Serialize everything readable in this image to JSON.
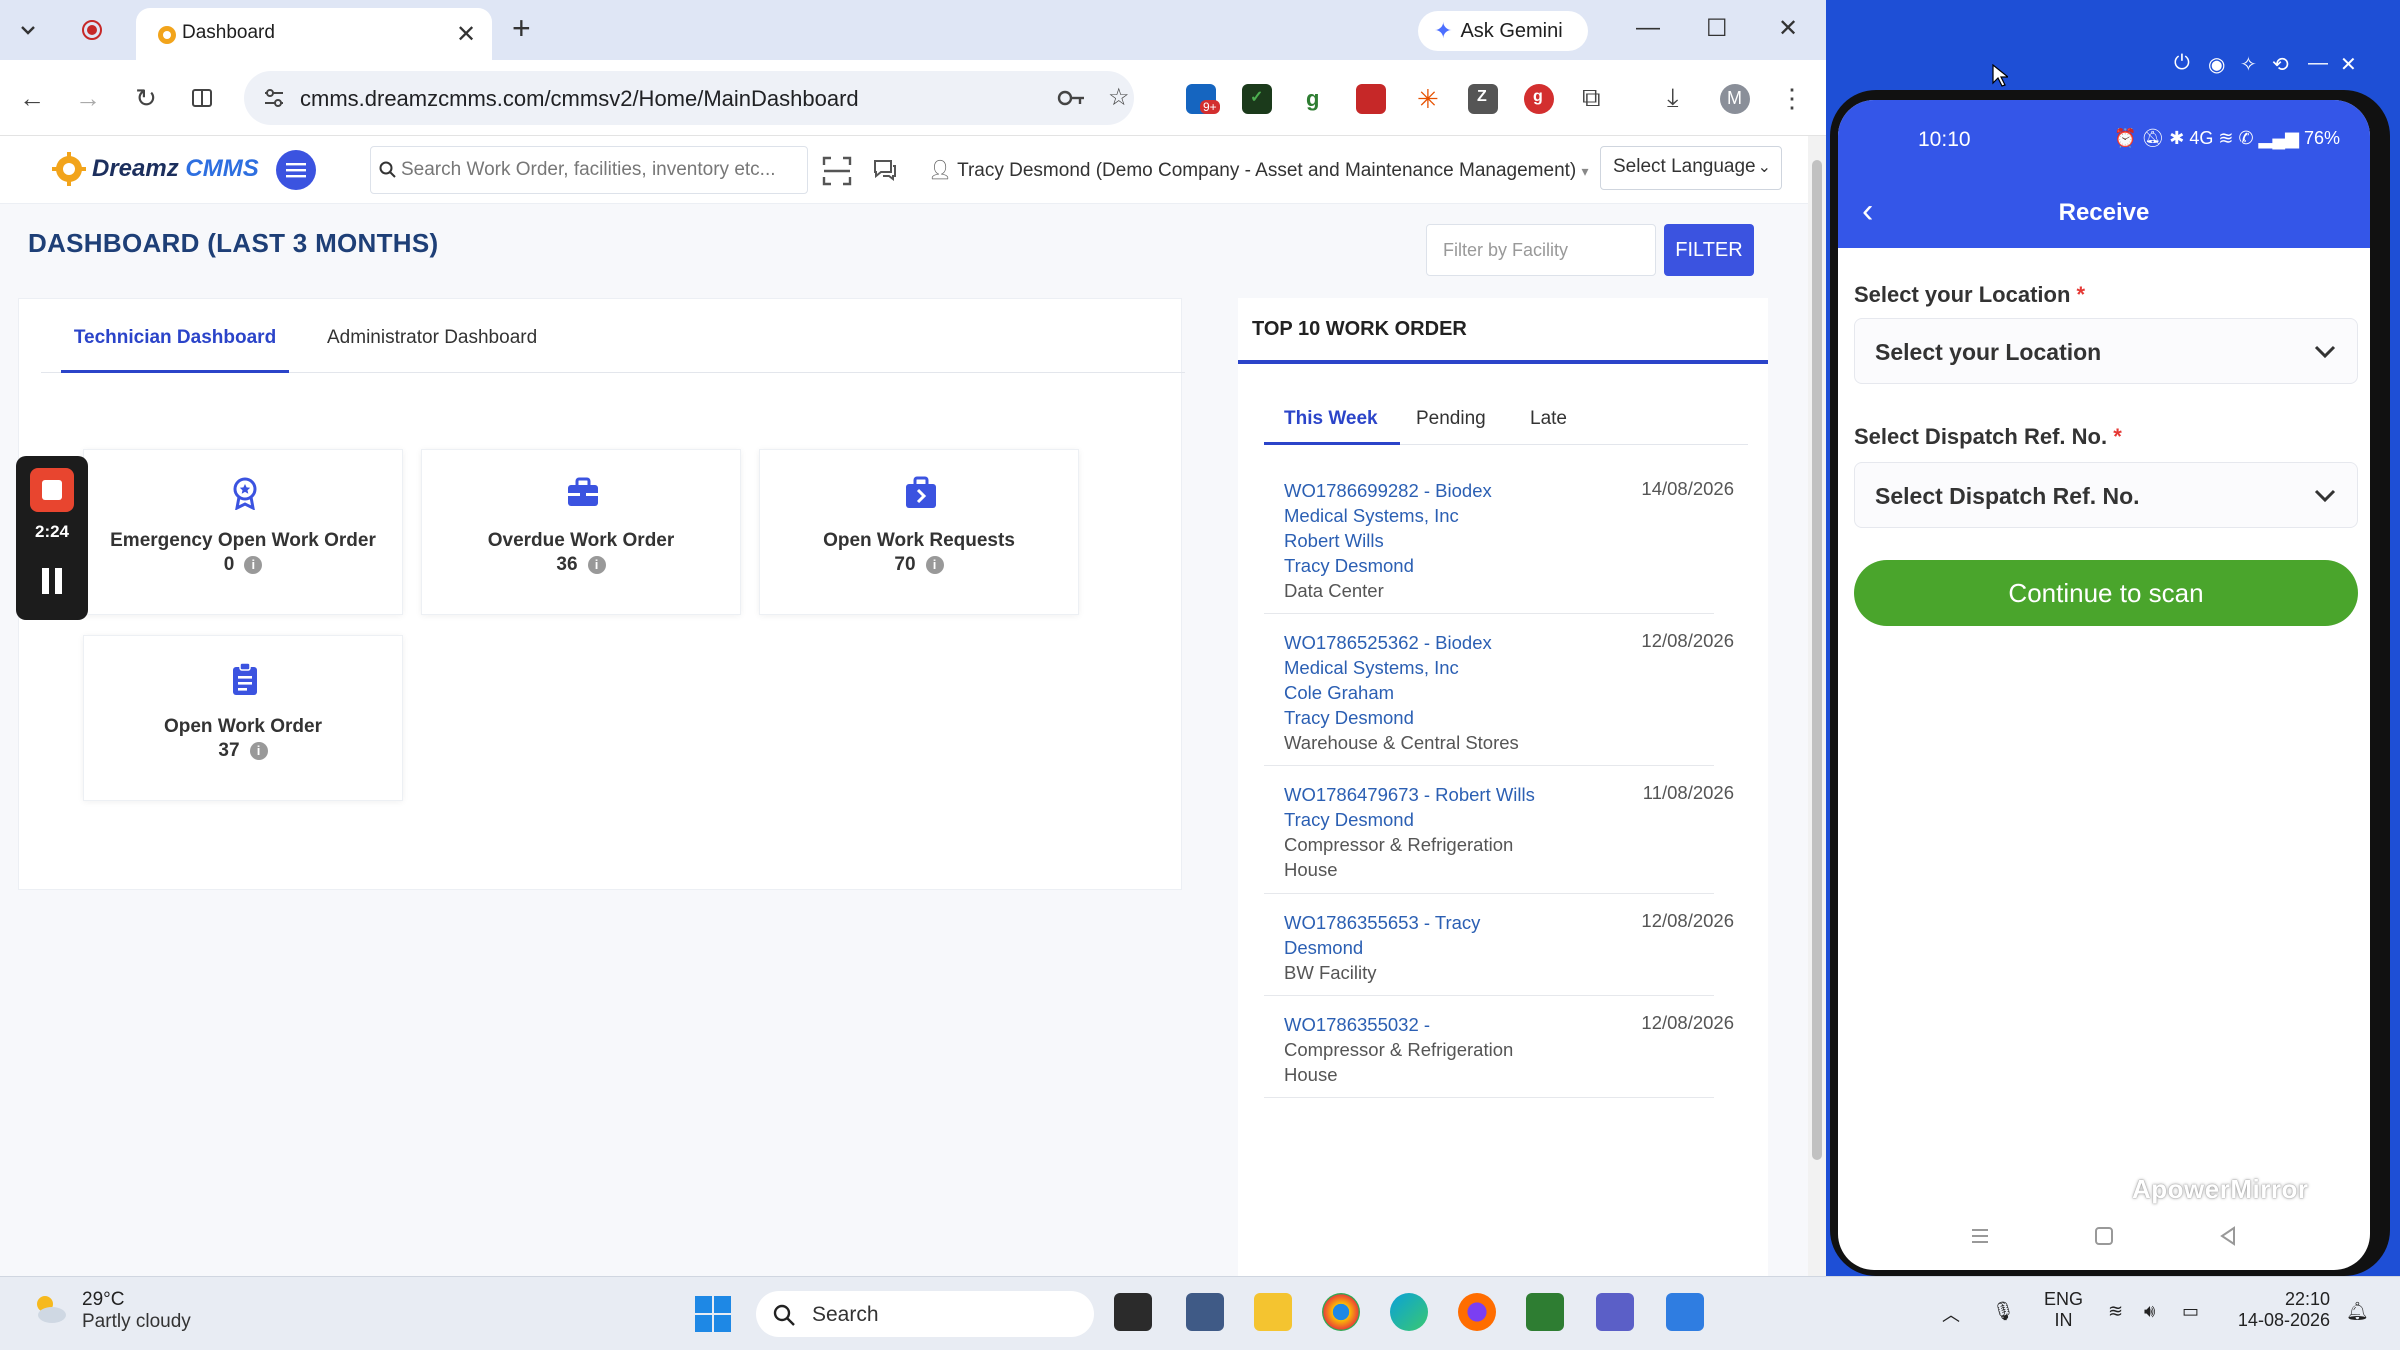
{
  "browser": {
    "tab_title": "Dashboard",
    "ask_gemini": "Ask Gemini",
    "url": "cmms.dreamzcmms.com/cmmsv2/Home/MainDashboard",
    "ext_badge": "9+",
    "profile_initial": "M"
  },
  "app": {
    "logo_prefix": "Dreamz",
    "logo_suffix": "CMMS",
    "search_placeholder": "Search Work Order, facilities, inventory etc...",
    "user": "Tracy Desmond (Demo Company - Asset and Maintenance Management)",
    "language": "Select Language"
  },
  "dashboard": {
    "title": "DASHBOARD (LAST 3 MONTHS)",
    "facility_placeholder": "Filter by Facility",
    "filter_label": "FILTER",
    "tabs": [
      "Technician Dashboard",
      "Administrator Dashboard"
    ],
    "kpis": [
      {
        "label": "Emergency Open Work Order",
        "value": "0"
      },
      {
        "label": "Overdue Work Order",
        "value": "36"
      },
      {
        "label": "Open Work Requests",
        "value": "70"
      },
      {
        "label": "Open Work Order",
        "value": "37"
      }
    ]
  },
  "top10": {
    "title": "TOP 10 WORK ORDER",
    "tabs": [
      "This Week",
      "Pending",
      "Late"
    ],
    "items": [
      {
        "lines": [
          "WO1786699282 - Biodex",
          "Medical Systems, Inc",
          "Robert Wills",
          "Tracy Desmond"
        ],
        "location": "Data Center",
        "date": "14/08/2026"
      },
      {
        "lines": [
          "WO1786525362 - Biodex",
          "Medical Systems, Inc",
          "Cole Graham",
          "Tracy Desmond"
        ],
        "location": "Warehouse & Central Stores",
        "date": "12/08/2026"
      },
      {
        "lines": [
          "WO1786479673 - Robert Wills",
          "Tracy Desmond"
        ],
        "location": "Compressor & Refrigeration House",
        "date": "11/08/2026"
      },
      {
        "lines": [
          "WO1786355653 - Tracy",
          "Desmond"
        ],
        "location": "BW Facility",
        "date": "12/08/2026"
      },
      {
        "lines": [
          "WO1786355032 -"
        ],
        "location": "Compressor & Refrigeration House",
        "date": "12/08/2026"
      }
    ]
  },
  "recorder": {
    "time": "2:24"
  },
  "phone": {
    "time": "10:10",
    "battery": "76%",
    "network": "4G",
    "title": "Receive",
    "location_label": "Select your Location",
    "location_value": "Select your Location",
    "dispatch_label": "Select Dispatch Ref. No.",
    "dispatch_value": "Select Dispatch Ref. No.",
    "required_mark": "*",
    "continue_label": "Continue to scan",
    "watermark": "ApowerMirror"
  },
  "taskbar": {
    "temperature": "29°C",
    "weather": "Partly cloudy",
    "search_label": "Search",
    "lang_top": "ENG",
    "lang_bottom": "IN",
    "clock_time": "22:10",
    "clock_date": "14-08-2026"
  },
  "colors": {
    "primary": "#3b53e0",
    "link": "#2b5fb3",
    "title": "#1e3f77",
    "phone_header": "#3456e8",
    "continue": "#4aa52c"
  }
}
